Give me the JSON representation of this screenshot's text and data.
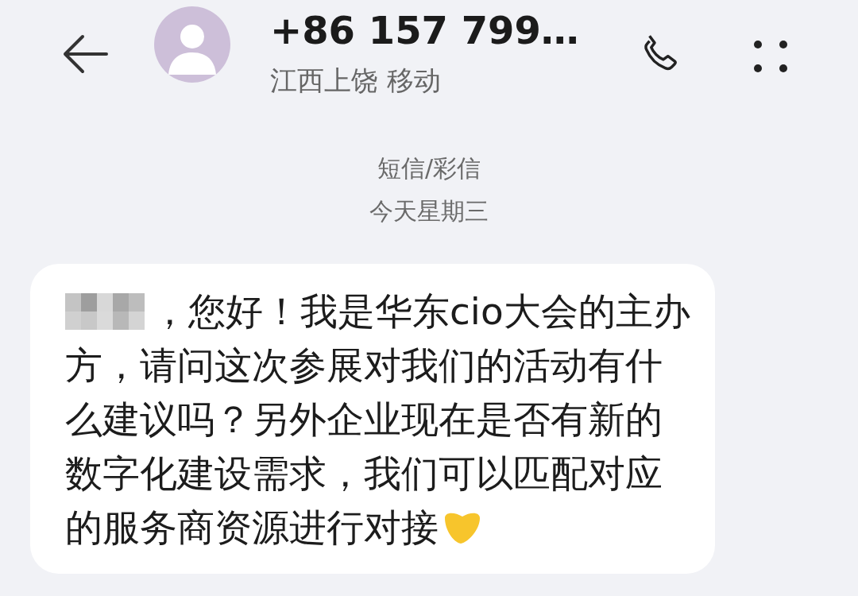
{
  "header": {
    "phone_number": "+86 157 799…",
    "location": "江西上饶 移动"
  },
  "channel_label": "短信/彩信",
  "date_label": "今天星期三",
  "messages": [
    {
      "kind": "received",
      "name_redacted": true,
      "text": "，您好！我是华东cio大会的主办方，请问这次参展对我们的活动有什么建议吗？另外企业现在是否有新的数字化建设需求，我们可以匹配对应的服务商资源进行对接",
      "heart_emoji": true
    }
  ]
}
